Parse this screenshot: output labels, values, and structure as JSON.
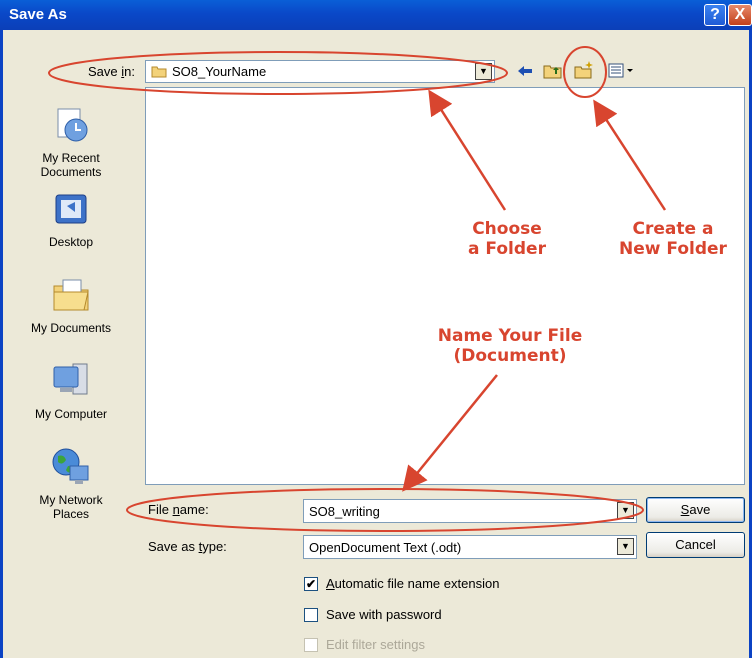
{
  "window": {
    "title": "Save As",
    "help_label": "?",
    "close_label": "X"
  },
  "savein": {
    "label_pre": "Save ",
    "label_u": "i",
    "label_post": "n:",
    "value": "SO8_YourName",
    "icons": [
      "back-arrow-icon",
      "up-folder-icon",
      "new-folder-icon",
      "views-menu-icon"
    ]
  },
  "places": [
    {
      "label_line1": "My Recent",
      "label_line2": "Documents",
      "icon": "recent-documents-icon"
    },
    {
      "label_line1": "Desktop",
      "label_line2": "",
      "icon": "desktop-icon"
    },
    {
      "label_line1": "My Documents",
      "label_line2": "",
      "icon": "my-documents-icon"
    },
    {
      "label_line1": "My Computer",
      "label_line2": "",
      "icon": "my-computer-icon"
    },
    {
      "label_line1": "My Network",
      "label_line2": "Places",
      "icon": "network-places-icon"
    }
  ],
  "filename": {
    "label_pre": "File ",
    "label_u": "n",
    "label_post": "ame:",
    "value": "SO8_writing"
  },
  "filetype": {
    "label_pre": "Save as ",
    "label_u": "t",
    "label_post": "ype:",
    "value": "OpenDocument Text (.odt)"
  },
  "buttons": {
    "save_u": "S",
    "save_rest": "ave",
    "cancel": "Cancel"
  },
  "options": {
    "auto_ext_u": "A",
    "auto_ext_rest": "utomatic file name extension",
    "auto_ext_checked": true,
    "password": "Save with password",
    "password_checked": false,
    "filter": "Edit filter settings",
    "filter_enabled": false
  },
  "annotations": {
    "folder_line1": "Choose",
    "folder_line2": "a Folder",
    "newfolder_line1": "Create a",
    "newfolder_line2": "New Folder",
    "name_line1": "Name Your File",
    "name_line2": "(Document)",
    "color": "#d8452f"
  },
  "check_mark": "✔"
}
